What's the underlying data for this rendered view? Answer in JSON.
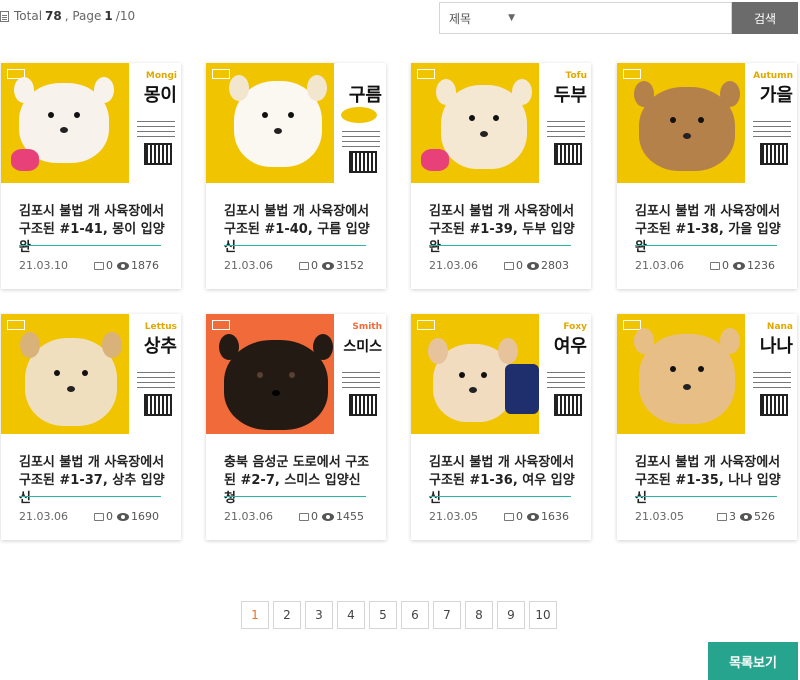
{
  "header": {
    "total_label": "Total",
    "total_count": "78",
    "page_label": ", Page",
    "current_page": "1",
    "total_pages": "/10"
  },
  "search": {
    "field_selected": "제목",
    "button_label": "검색"
  },
  "cards": [
    {
      "eng": "Mongi",
      "kor": "몽이",
      "title": "김포시 불법 개 사육장에서 구조된 #1-41, 몽이 입양완",
      "date": "21.03.10",
      "comments": "0",
      "views": "1876"
    },
    {
      "eng": "",
      "kor": "구름",
      "title": "김포시 불법 개 사육장에서 구조된 #1-40, 구름 입양신",
      "date": "21.03.06",
      "comments": "0",
      "views": "3152"
    },
    {
      "eng": "Tofu",
      "kor": "두부",
      "title": "김포시 불법 개 사육장에서 구조된 #1-39, 두부 입양완",
      "date": "21.03.06",
      "comments": "0",
      "views": "2803"
    },
    {
      "eng": "Autumn",
      "kor": "가을",
      "title": "김포시 불법 개 사육장에서 구조된 #1-38, 가을 입양완",
      "date": "21.03.06",
      "comments": "0",
      "views": "1236"
    },
    {
      "eng": "Lettus",
      "kor": "상추",
      "title": "김포시 불법 개 사육장에서 구조된 #1-37, 상추 입양신",
      "date": "21.03.06",
      "comments": "0",
      "views": "1690"
    },
    {
      "eng": "Smith",
      "kor": "스미스",
      "title": "충북 음성군 도로에서 구조된 #2-7, 스미스 입양신청",
      "date": "21.03.06",
      "comments": "0",
      "views": "1455"
    },
    {
      "eng": "Foxy",
      "kor": "여우",
      "title": "김포시 불법 개 사육장에서 구조된 #1-36, 여우 입양신",
      "date": "21.03.05",
      "comments": "0",
      "views": "1636"
    },
    {
      "eng": "Nana",
      "kor": "나나",
      "title": "김포시 불법 개 사육장에서 구조된 #1-35, 나나 입양신",
      "date": "21.03.05",
      "comments": "3",
      "views": "526"
    }
  ],
  "pagination": {
    "pages": [
      "1",
      "2",
      "3",
      "4",
      "5",
      "6",
      "7",
      "8",
      "9",
      "10"
    ]
  },
  "list_button_label": "목록보기",
  "colors": {
    "accent_teal": "#26a48e",
    "poster_yellow": "#f1c400",
    "poster_orange": "#f06a3a",
    "active_page": "#f07024",
    "search_button": "#6b6b6b"
  }
}
